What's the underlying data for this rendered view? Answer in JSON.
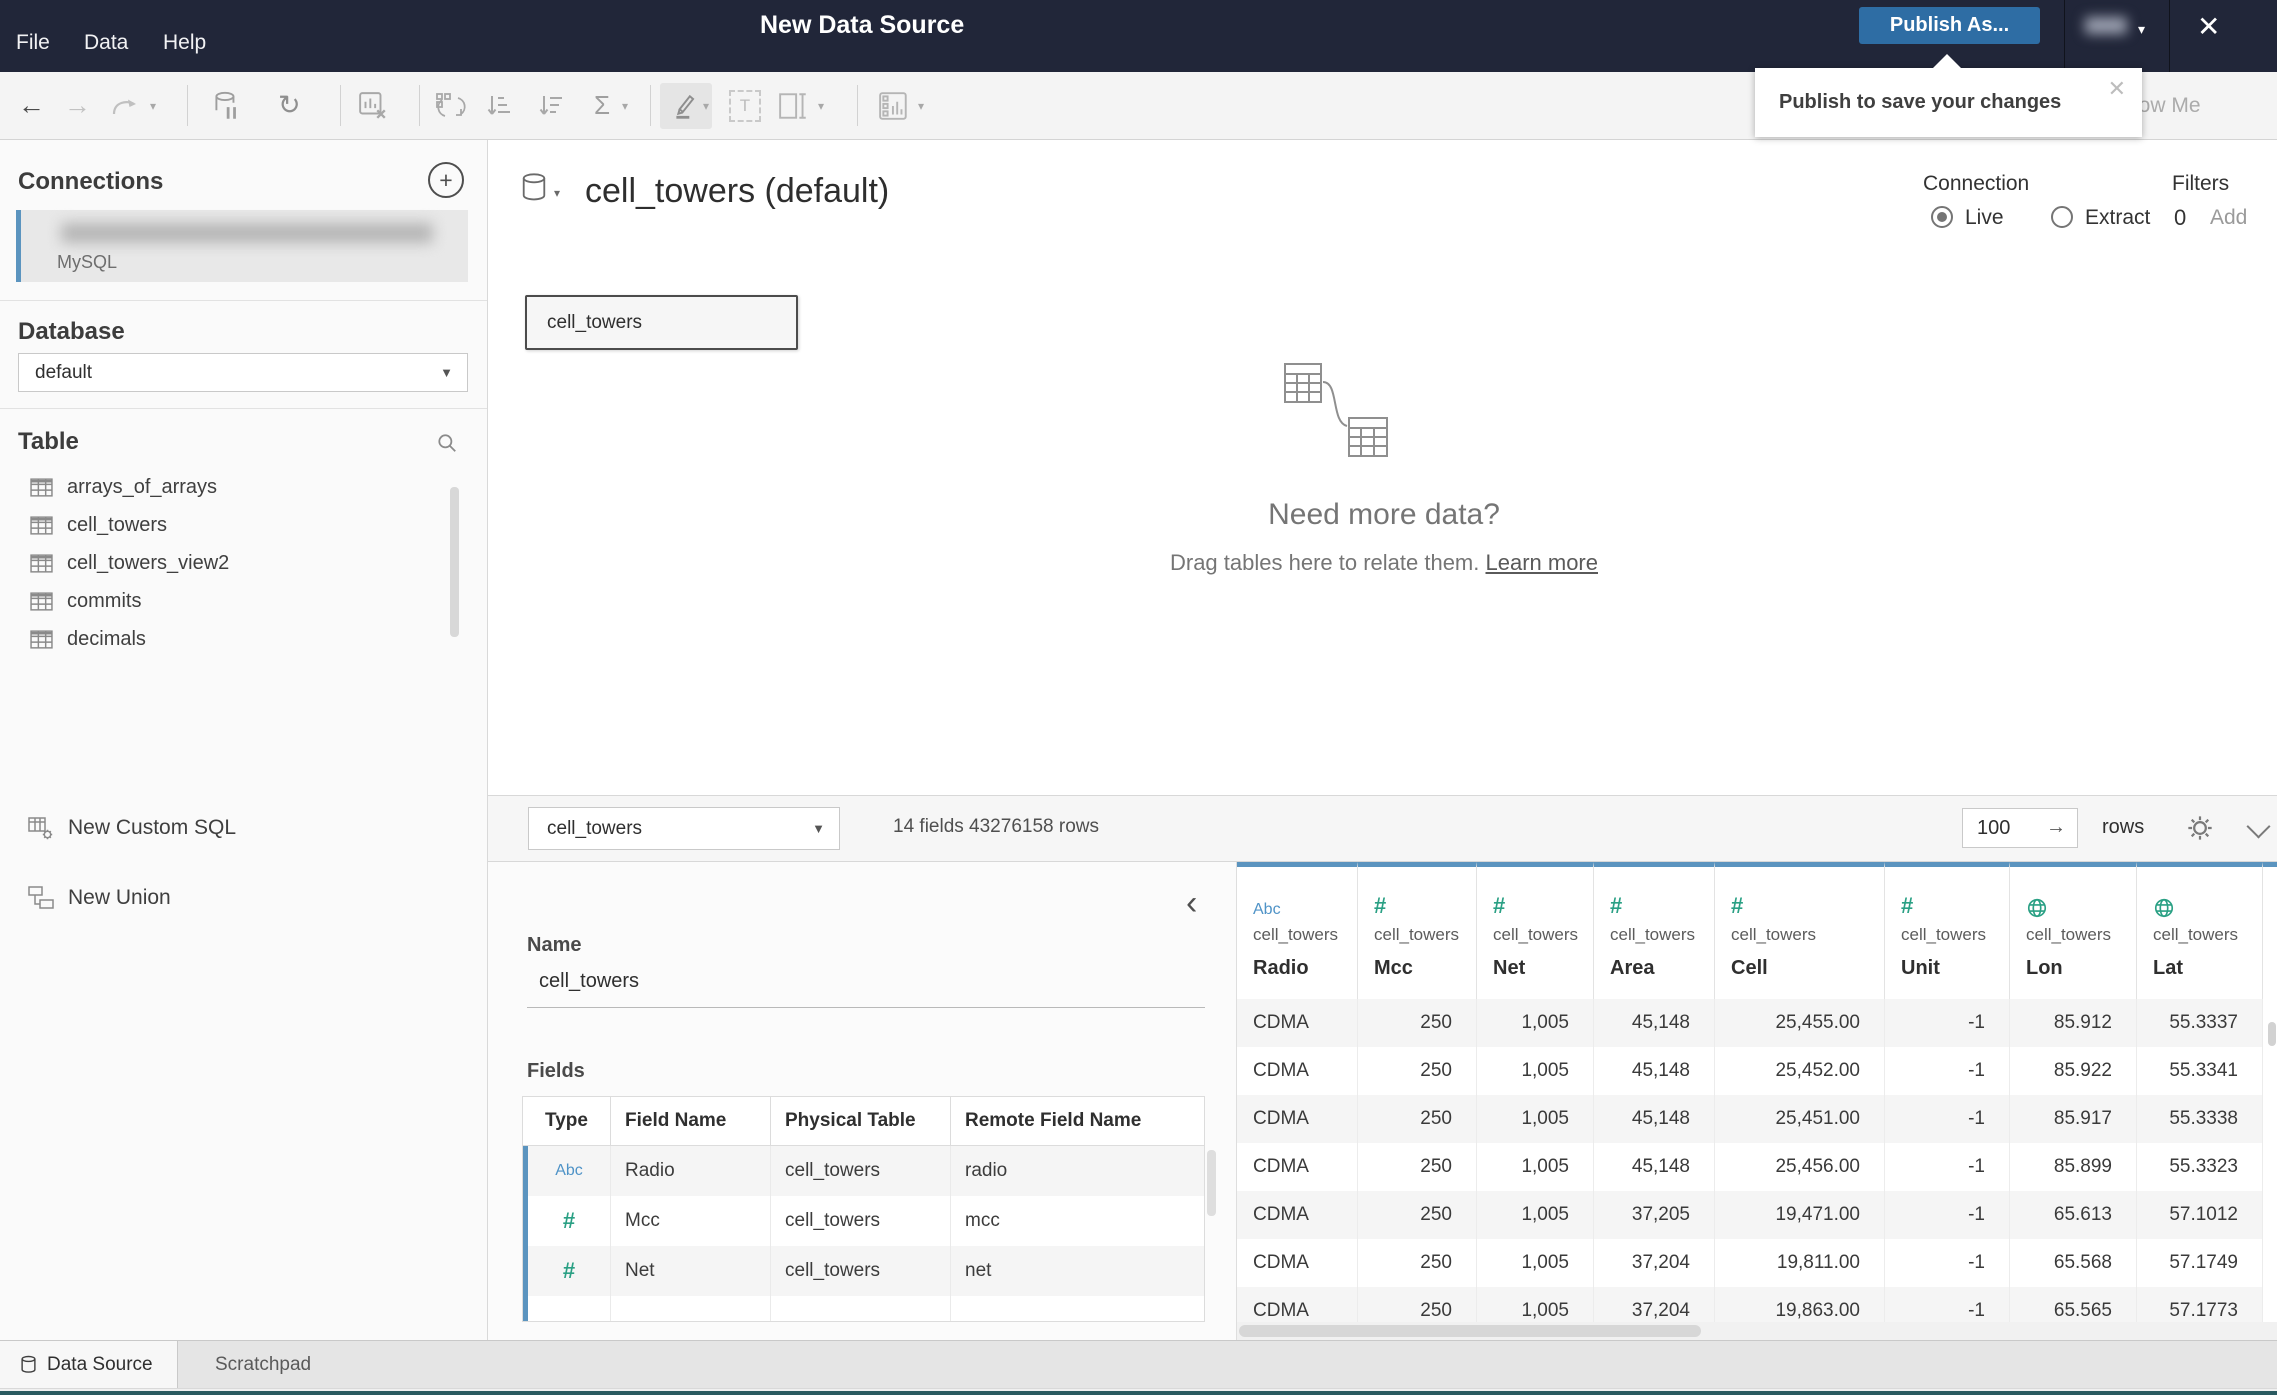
{
  "topbar": {
    "menus": [
      "File",
      "Data",
      "Help"
    ],
    "title": "New Data Source",
    "publish_label": "Publish As...",
    "close_glyph": "✕"
  },
  "tooltip": {
    "text": "Publish to save your changes",
    "close_glyph": "✕"
  },
  "toolbar": {
    "show_me": "Show Me"
  },
  "sidebar": {
    "connections_title": "Connections",
    "connection": {
      "type": "MySQL"
    },
    "database_title": "Database",
    "database_value": "default",
    "table_title": "Table",
    "tables": [
      "arrays_of_arrays",
      "cell_towers",
      "cell_towers_view2",
      "commits",
      "decimals"
    ],
    "actions": {
      "custom_sql": "New Custom SQL",
      "union": "New Union"
    }
  },
  "canvas": {
    "title": "cell_towers (default)",
    "connection_label": "Connection",
    "live_label": "Live",
    "extract_label": "Extract",
    "filters_label": "Filters",
    "filters_count": "0",
    "filters_add": "Add",
    "table_card": "cell_towers",
    "empty_title": "Need more data?",
    "empty_text": "Drag tables here to relate them. ",
    "empty_link": "Learn more"
  },
  "preview_bar": {
    "table_select": "cell_towers",
    "summary": "14 fields 43276158 rows",
    "row_count": "100",
    "rows_label": "rows"
  },
  "fields_panel": {
    "name_label": "Name",
    "name_value": "cell_towers",
    "fields_label": "Fields",
    "columns": [
      "Type",
      "Field Name",
      "Physical Table",
      "Remote Field Name"
    ],
    "rows": [
      {
        "type": "Abc",
        "name": "Radio",
        "table": "cell_towers",
        "remote": "radio"
      },
      {
        "type": "#",
        "name": "Mcc",
        "table": "cell_towers",
        "remote": "mcc"
      },
      {
        "type": "#",
        "name": "Net",
        "table": "cell_towers",
        "remote": "net"
      }
    ]
  },
  "grid": {
    "columns": [
      {
        "icon": "Abc",
        "table": "cell_towers",
        "name": "Radio"
      },
      {
        "icon": "#",
        "table": "cell_towers",
        "name": "Mcc"
      },
      {
        "icon": "#",
        "table": "cell_towers",
        "name": "Net"
      },
      {
        "icon": "#",
        "table": "cell_towers",
        "name": "Area"
      },
      {
        "icon": "#",
        "table": "cell_towers",
        "name": "Cell"
      },
      {
        "icon": "#",
        "table": "cell_towers",
        "name": "Unit"
      },
      {
        "icon": "globe",
        "table": "cell_towers",
        "name": "Lon"
      },
      {
        "icon": "globe",
        "table": "cell_towers",
        "name": "Lat"
      }
    ],
    "rows": [
      [
        "CDMA",
        "250",
        "1,005",
        "45,148",
        "25,455.00",
        "-1",
        "85.912",
        "55.3337"
      ],
      [
        "CDMA",
        "250",
        "1,005",
        "45,148",
        "25,452.00",
        "-1",
        "85.922",
        "55.3341"
      ],
      [
        "CDMA",
        "250",
        "1,005",
        "45,148",
        "25,451.00",
        "-1",
        "85.917",
        "55.3338"
      ],
      [
        "CDMA",
        "250",
        "1,005",
        "45,148",
        "25,456.00",
        "-1",
        "85.899",
        "55.3323"
      ],
      [
        "CDMA",
        "250",
        "1,005",
        "37,205",
        "19,471.00",
        "-1",
        "65.613",
        "57.1012"
      ],
      [
        "CDMA",
        "250",
        "1,005",
        "37,204",
        "19,811.00",
        "-1",
        "65.568",
        "57.1749"
      ],
      [
        "CDMA",
        "250",
        "1,005",
        "37,204",
        "19,863.00",
        "-1",
        "65.565",
        "57.1773"
      ]
    ]
  },
  "tabs": [
    {
      "label": "Data Source"
    },
    {
      "label": "Scratchpad"
    }
  ],
  "colors": {
    "topbar": "#212639",
    "publish_blue": "#2e6da4",
    "accent_blue": "#5b94bf",
    "type_green": "#2aa084",
    "type_blue": "#4f93c7"
  }
}
